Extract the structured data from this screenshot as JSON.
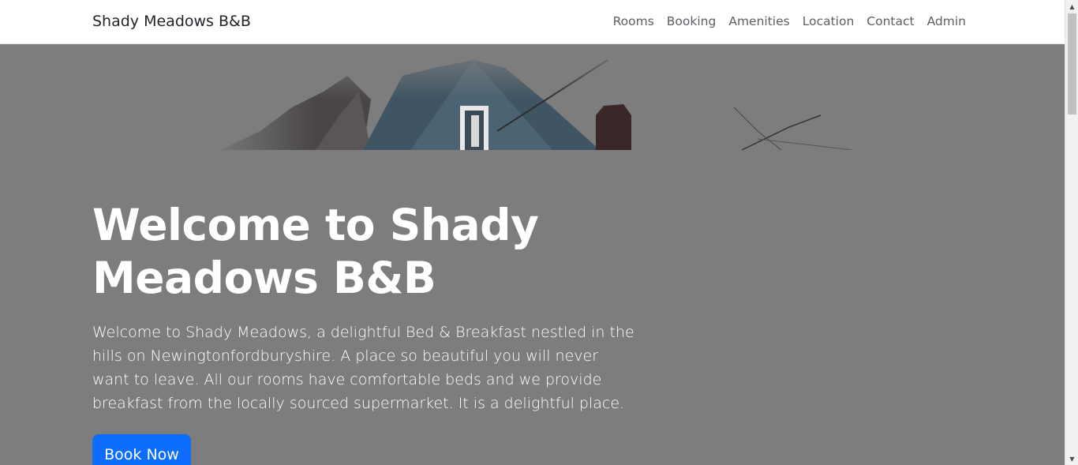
{
  "navbar": {
    "brand": "Shady Meadows B&B",
    "links": [
      "Rooms",
      "Booking",
      "Amenities",
      "Location",
      "Contact",
      "Admin"
    ]
  },
  "hero": {
    "title": "Welcome to Shady Meadows B&B",
    "text": "Welcome to Shady Meadows, a delightful Bed & Breakfast nestled in the hills on Newingtonfordburyshire. A place so beautiful you will never want to leave. All our rooms have comfortable beds and we provide breakfast from the locally sourced supermarket. It is a delightful place.",
    "button_label": "Book Now",
    "background_color": "#7d7d7d",
    "button_color": "#0d6efd"
  },
  "scrollbar": {
    "up_icon": "▲",
    "down_icon": "▼"
  }
}
